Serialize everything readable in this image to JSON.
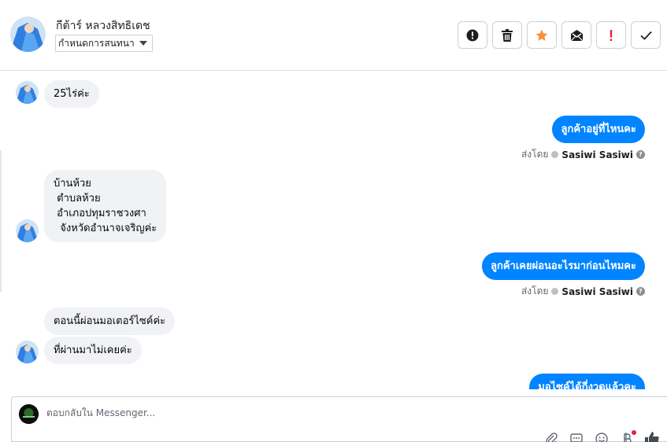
{
  "header": {
    "contact_name": "กีต้าร์ หลวงสิทธิเดช",
    "label_select": "กำหนดการสนทนา",
    "actions": [
      {
        "name": "spam-button",
        "icon": "exclamation-circle-icon"
      },
      {
        "name": "delete-button",
        "icon": "trash-icon"
      },
      {
        "name": "star-button",
        "icon": "star-icon"
      },
      {
        "name": "unread-button",
        "icon": "envelope-icon"
      },
      {
        "name": "follow-up-button",
        "icon": "exclamation-icon"
      },
      {
        "name": "done-button",
        "icon": "checkmark-icon"
      }
    ]
  },
  "messages": [
    {
      "dir": "in",
      "text": "25ไร่ค่ะ"
    },
    {
      "dir": "out",
      "text": "ลูกค้าอยู่ที่ไหนคะ",
      "sent_by_prefix": "ส่งโดย",
      "sent_by": "Sasiwi Sasiwi"
    },
    {
      "dir": "in",
      "text": "บ้านห้วย\n ตำบลห้วย\n อำเภอปทุมราชวงศา\n  จังหวัดอำนาจเจริญค่ะ"
    },
    {
      "dir": "out",
      "text": "ลูกค้าเคยผ่อนอะไรมาก่อนไหมคะ",
      "sent_by_prefix": "ส่งโดย",
      "sent_by": "Sasiwi Sasiwi"
    },
    {
      "dir": "in",
      "text": "ตอนนี้ผ่อนมอเตอร์ไซค์ค่ะ"
    },
    {
      "dir": "in",
      "text": "ที่ผ่านมาไม่เคยค่ะ"
    },
    {
      "dir": "out",
      "text": "มอไซค์ได้กี่งวดแล้วคะ"
    }
  ],
  "composer": {
    "placeholder": "ตอบกลับใน Messenger...",
    "tools": [
      "paperclip-icon",
      "saved-reply-icon",
      "emoji-icon",
      "payment-icon",
      "like-icon"
    ]
  },
  "colors": {
    "accent": "#0084ff",
    "incoming_bubble": "#f0f2f5",
    "star": "#f7923b",
    "follow_up": "#e41e3f"
  }
}
